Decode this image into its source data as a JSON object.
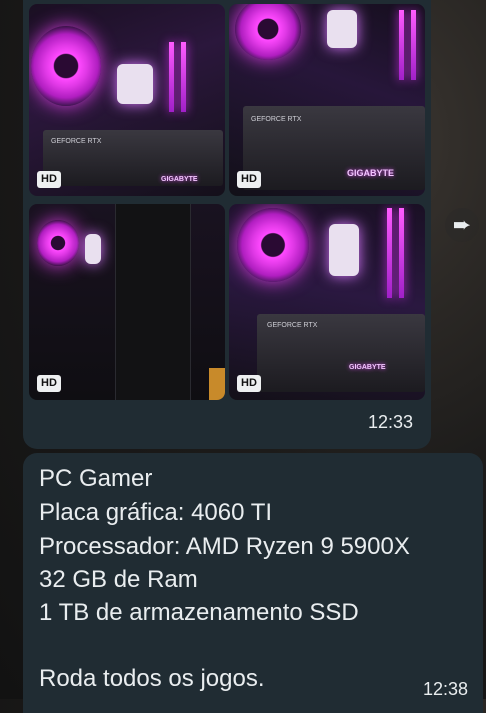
{
  "media_message": {
    "photos": [
      {
        "badge": "HD",
        "gpu_label": "GEFORCE RTX",
        "brand_label": "GIGABYTE"
      },
      {
        "badge": "HD",
        "gpu_label": "GEFORCE RTX",
        "brand_label": "GIGABYTE"
      },
      {
        "badge": "HD"
      },
      {
        "badge": "HD",
        "gpu_label": "GEFORCE RTX",
        "brand_label": "GIGABYTE"
      }
    ],
    "time": "12:33"
  },
  "forward_icon": "forward-icon",
  "text_message": {
    "lines": [
      "PC Gamer",
      "Placa gráfica: 4060 TI",
      "Processador: AMD Ryzen 9 5900X",
      "32 GB de Ram",
      "1 TB de armazenamento SSD",
      "",
      "Roda todos os jogos."
    ],
    "time": "12:38"
  }
}
